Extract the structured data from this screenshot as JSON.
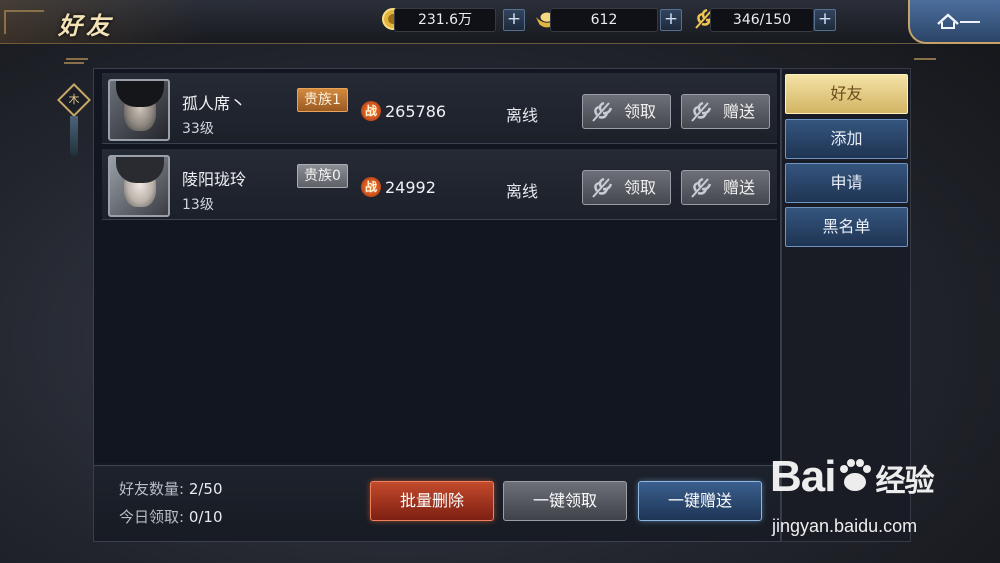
{
  "header": {
    "title": "好友",
    "resources": [
      {
        "icon": "coin-icon",
        "value": "231.6万"
      },
      {
        "icon": "gold-ingot-icon",
        "value": "612"
      },
      {
        "icon": "golden-leaf-icon",
        "value": "346/150"
      }
    ],
    "plus_label": "+"
  },
  "ornament": {
    "glyph": "木"
  },
  "friends": [
    {
      "name": "孤人席丶",
      "level": "33级",
      "rank": "贵族1",
      "power_icon": "战",
      "power": "265786",
      "status": "离线",
      "claim_label": "领取",
      "gift_label": "赠送"
    },
    {
      "name": "陵阳珑玲",
      "level": "13级",
      "rank": "贵族0",
      "power_icon": "战",
      "power": "24992",
      "status": "离线",
      "claim_label": "领取",
      "gift_label": "赠送"
    }
  ],
  "footer": {
    "friend_count_label": "好友数量: ",
    "friend_count": "2/50",
    "daily_claim_label": "今日领取: ",
    "daily_claim": "0/10",
    "batch_delete": "批量删除",
    "claim_all": "一键领取",
    "gift_all": "一键赠送"
  },
  "tabs": [
    {
      "label": "好友",
      "active": true
    },
    {
      "label": "添加",
      "active": false
    },
    {
      "label": "申请",
      "active": false
    },
    {
      "label": "黑名单",
      "active": false
    }
  ],
  "watermark": {
    "brand": "Bai",
    "brand_suffix": "经验",
    "url": "jingyan.baidu.com"
  },
  "colors": {
    "accent_gold": "#d2b463",
    "accent_blue": "#35557e",
    "danger": "#c34a2c"
  }
}
